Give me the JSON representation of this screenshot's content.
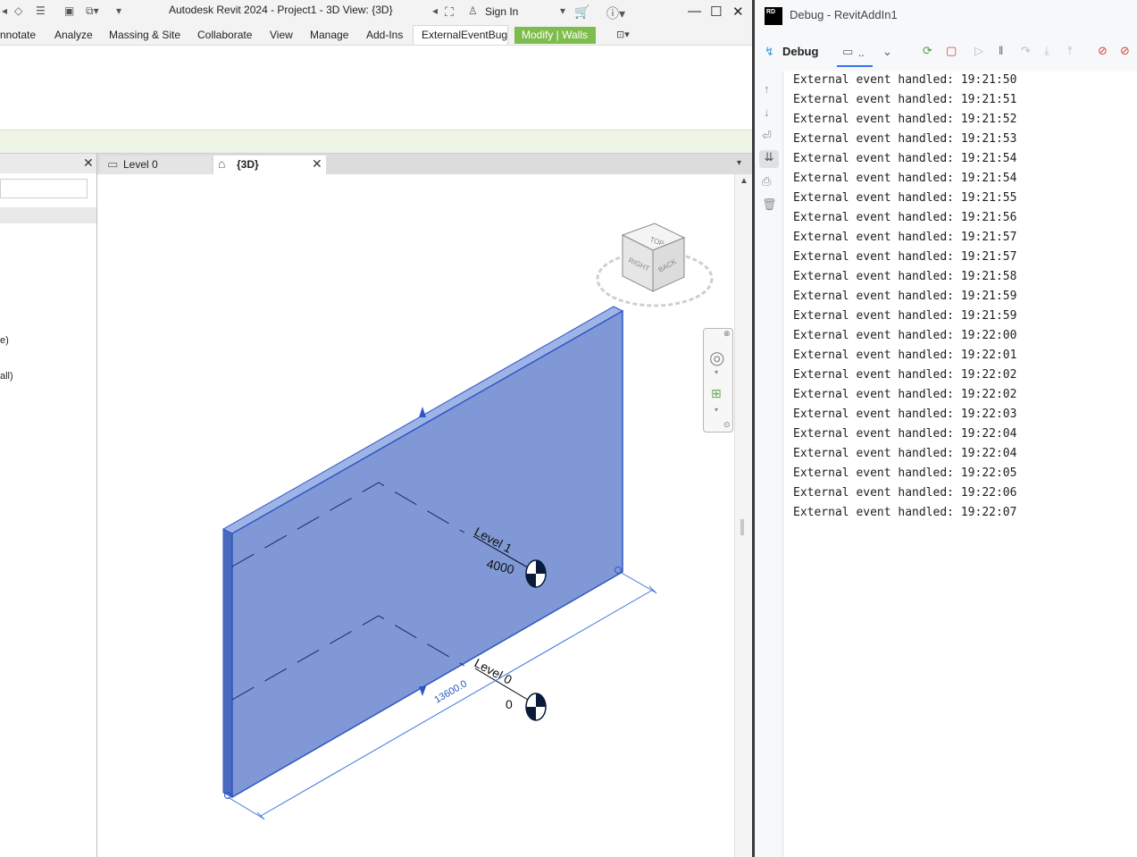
{
  "revit": {
    "title": "Autodesk Revit 2024 - Project1 - 3D View: {3D}",
    "sign_in": "Sign In",
    "ribbon_tabs": [
      "nnotate",
      "Analyze",
      "Massing & Site",
      "Collaborate",
      "View",
      "Manage",
      "Add-Ins",
      "ExternalEventBug"
    ],
    "modify_tab": "Modify | Walls",
    "left_fragments": [
      "e)",
      "all)"
    ],
    "view_tabs": [
      {
        "label": "Level 0"
      },
      {
        "label": "{3D}"
      }
    ],
    "viewcube": {
      "top": "TOP",
      "right": "RIGHT",
      "back": "BACK"
    },
    "levels": [
      {
        "name": "Level 1",
        "elevation": "4000"
      },
      {
        "name": "Level 0",
        "elevation": "0"
      }
    ],
    "dimension": "13600.0",
    "colors": {
      "wall": "#8099d6",
      "wall_edge": "#2e55c4",
      "modify_tab": "#7fbc4e"
    }
  },
  "debug": {
    "window_title": "Debug - RevitAddIn1",
    "logo": "RD",
    "tab_label": "Debug",
    "console_tab": "..",
    "log_lines": [
      "External event handled: 19:21:50",
      "External event handled: 19:21:51",
      "External event handled: 19:21:52",
      "External event handled: 19:21:53",
      "External event handled: 19:21:54",
      "External event handled: 19:21:54",
      "External event handled: 19:21:55",
      "External event handled: 19:21:56",
      "External event handled: 19:21:57",
      "External event handled: 19:21:57",
      "External event handled: 19:21:58",
      "External event handled: 19:21:59",
      "External event handled: 19:21:59",
      "External event handled: 19:22:00",
      "External event handled: 19:22:01",
      "External event handled: 19:22:02",
      "External event handled: 19:22:02",
      "External event handled: 19:22:03",
      "External event handled: 19:22:04",
      "External event handled: 19:22:04",
      "External event handled: 19:22:05",
      "External event handled: 19:22:06",
      "External event handled: 19:22:07"
    ]
  }
}
